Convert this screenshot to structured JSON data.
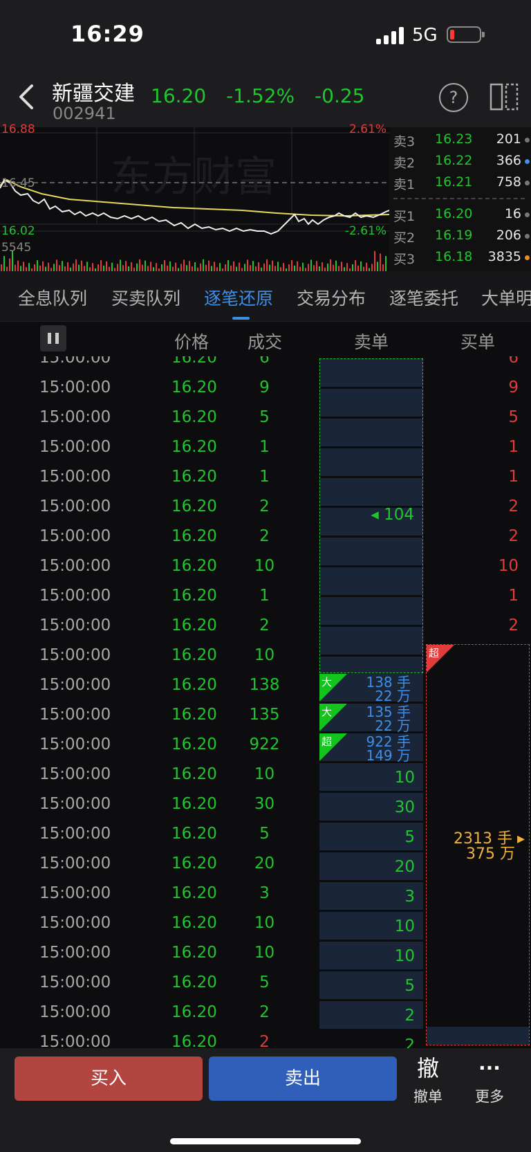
{
  "status_bar": {
    "time": "16:29",
    "network": "5G"
  },
  "header": {
    "stock_name": "新疆交建",
    "stock_code": "002941",
    "price": "16.20",
    "change_pct": "-1.52%",
    "change": "-0.25",
    "help_label": "?"
  },
  "chart": {
    "high_label": "16.88",
    "low_label": "16.02",
    "ref_label": "16.45",
    "up_pct": "2.61%",
    "down_pct": "-2.61%",
    "volume_label": "5545",
    "watermark": "东方财富"
  },
  "orderbook": {
    "asks": [
      {
        "label": "卖3",
        "price": "16.23",
        "volume": "201"
      },
      {
        "label": "卖2",
        "price": "16.22",
        "volume": "366"
      },
      {
        "label": "卖1",
        "price": "16.21",
        "volume": "758"
      }
    ],
    "bids": [
      {
        "label": "买1",
        "price": "16.20",
        "volume": "16"
      },
      {
        "label": "买2",
        "price": "16.19",
        "volume": "206"
      },
      {
        "label": "买3",
        "price": "16.18",
        "volume": "3835"
      }
    ]
  },
  "tabs": [
    "全息队列",
    "买卖队列",
    "逐笔还原",
    "交易分布",
    "逐笔委托",
    "大单明"
  ],
  "columns": {
    "price": "价格",
    "volume": "成交",
    "sell": "卖单",
    "buy": "买单"
  },
  "trades": [
    {
      "time": "15:00:00",
      "price": "16.20",
      "volume": "6",
      "buy": "6"
    },
    {
      "time": "15:00:00",
      "price": "16.20",
      "volume": "9",
      "buy": "9"
    },
    {
      "time": "15:00:00",
      "price": "16.20",
      "volume": "5",
      "buy": "5"
    },
    {
      "time": "15:00:00",
      "price": "16.20",
      "volume": "1",
      "buy": "1"
    },
    {
      "time": "15:00:00",
      "price": "16.20",
      "volume": "1",
      "buy": "1"
    },
    {
      "time": "15:00:00",
      "price": "16.20",
      "volume": "2",
      "buy": "2"
    },
    {
      "time": "15:00:00",
      "price": "16.20",
      "volume": "2",
      "buy": "2"
    },
    {
      "time": "15:00:00",
      "price": "16.20",
      "volume": "10",
      "buy": "10"
    },
    {
      "time": "15:00:00",
      "price": "16.20",
      "volume": "1",
      "buy": "1"
    },
    {
      "time": "15:00:00",
      "price": "16.20",
      "volume": "2",
      "buy": "2"
    },
    {
      "time": "15:00:00",
      "price": "16.20",
      "volume": "10",
      "buy": ""
    },
    {
      "time": "15:00:00",
      "price": "16.20",
      "volume": "138",
      "buy": ""
    },
    {
      "time": "15:00:00",
      "price": "16.20",
      "volume": "135",
      "buy": ""
    },
    {
      "time": "15:00:00",
      "price": "16.20",
      "volume": "922",
      "buy": ""
    },
    {
      "time": "15:00:00",
      "price": "16.20",
      "volume": "10",
      "buy": ""
    },
    {
      "time": "15:00:00",
      "price": "16.20",
      "volume": "30",
      "buy": ""
    },
    {
      "time": "15:00:00",
      "price": "16.20",
      "volume": "5",
      "buy": ""
    },
    {
      "time": "15:00:00",
      "price": "16.20",
      "volume": "20",
      "buy": ""
    },
    {
      "time": "15:00:00",
      "price": "16.20",
      "volume": "3",
      "buy": ""
    },
    {
      "time": "15:00:00",
      "price": "16.20",
      "volume": "10",
      "buy": ""
    },
    {
      "time": "15:00:00",
      "price": "16.20",
      "volume": "10",
      "buy": ""
    },
    {
      "time": "15:00:00",
      "price": "16.20",
      "volume": "5",
      "buy": ""
    },
    {
      "time": "15:00:00",
      "price": "16.20",
      "volume": "2",
      "buy": ""
    },
    {
      "time": "15:00:00",
      "price": "16.20",
      "volume": "2",
      "buy": ""
    }
  ],
  "sell_orders": {
    "merged_104": "104",
    "big1": {
      "tag": "大",
      "lots": "138 手",
      "amount": "22 万"
    },
    "big2": {
      "tag": "大",
      "lots": "135 手",
      "amount": "22 万"
    },
    "big3": {
      "tag": "超",
      "lots": "922 手",
      "amount": "149 万"
    },
    "singles": [
      "10",
      "30",
      "5",
      "20",
      "3",
      "10",
      "10",
      "5",
      "2",
      "2"
    ]
  },
  "buy_super": {
    "tag": "超",
    "lots": "2313 手",
    "amount": "375 万"
  },
  "bottom": {
    "buy": "买入",
    "sell": "卖出",
    "cancel_icon": "撤",
    "cancel": "撤单",
    "more_icon": "···",
    "more": "更多"
  },
  "colors": {
    "up": "#e23b3b",
    "down": "#1fc62d",
    "accent": "#3d8fe8",
    "buy_btn": "#b24540",
    "sell_btn": "#2f5fb8"
  }
}
